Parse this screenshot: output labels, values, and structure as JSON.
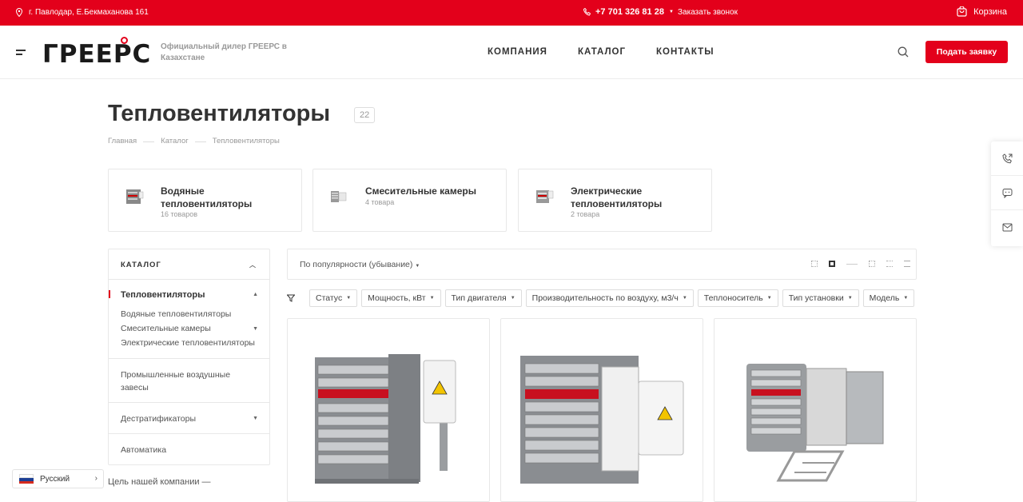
{
  "topbar": {
    "address": "г. Павлодар, Е.Бекмаханова 161",
    "phone": "+7 701 326 81 28",
    "callback": "Заказать звонок",
    "cart": "Корзина"
  },
  "header": {
    "logo": "ГРЕЕРС",
    "dealer": "Официальный дилер ГРЕЕРС в Казахстане",
    "nav": [
      "КОМПАНИЯ",
      "КАТАЛОГ",
      "КОНТАКТЫ"
    ],
    "cta": "Подать заявку"
  },
  "page": {
    "title": "Тепловентиляторы",
    "count": "22",
    "breadcrumbs": [
      "Главная",
      "Каталог",
      "Тепловентиляторы"
    ]
  },
  "subcategories": [
    {
      "name": "Водяные тепловентиляторы",
      "count": "16 товаров"
    },
    {
      "name": "Смесительные камеры",
      "count": "4 товара"
    },
    {
      "name": "Электрические тепловентиляторы",
      "count": "2 товара"
    }
  ],
  "sidebar": {
    "header": "КАТАЛОГ",
    "current": "Тепловентиляторы",
    "sub": [
      "Водяные тепловентиляторы",
      "Смесительные камеры",
      "Электрические тепловентиляторы"
    ],
    "groups": [
      "Промышленные воздушные завесы",
      "Дестратификаторы",
      "Автоматика"
    ]
  },
  "goal_text": "Цель нашей компании —",
  "sort": "По популярности (убывание)",
  "filters": [
    "Статус",
    "Мощность, кВт",
    "Тип двигателя",
    "Производительность по воздуху, м3/ч",
    "Теплоноситель",
    "Тип установки",
    "Модель"
  ],
  "language": "Русский",
  "colors": {
    "brand": "#e3001b"
  }
}
